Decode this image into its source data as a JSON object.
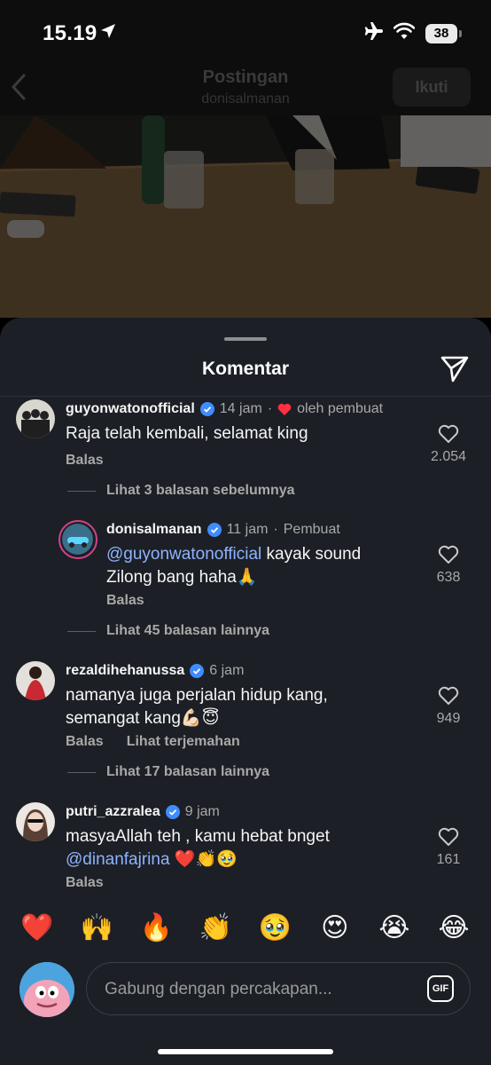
{
  "status_bar": {
    "time": "15.19",
    "battery": "38",
    "icons": [
      "location-arrow-icon",
      "airplane-icon",
      "wifi-icon",
      "battery-icon"
    ]
  },
  "nav": {
    "title": "Postingan",
    "subtitle": "donisalmanan",
    "follow_label": "Ikuti",
    "back_icon": "chevron-left-icon"
  },
  "sheet": {
    "title": "Komentar",
    "share_icon": "send-icon"
  },
  "comments": [
    {
      "username": "guyonwatonofficial",
      "verified": true,
      "time": "14 jam",
      "creator_tag": "oleh pembuat",
      "text": "Raja telah kembali, selamat king",
      "reply_label": "Balas",
      "likes": "2.054",
      "more_replies": "Lihat 3 balasan sebelumnya"
    },
    {
      "username": "donisalmanan",
      "verified": true,
      "time": "11 jam",
      "role": "Pembuat",
      "mention": "@guyonwatonofficial",
      "text_after_mention": " kayak sound",
      "text_line2": "Zilong bang  haha🙏",
      "reply_label": "Balas",
      "likes": "638",
      "more_replies": "Lihat 45 balasan lainnya"
    },
    {
      "username": "rezaldihehanussa",
      "verified": true,
      "time": "6 jam",
      "text_line1": "namanya juga perjalan hidup kang,",
      "text_line2": "semangat kang💪🏻😇",
      "reply_label": "Balas",
      "translate_label": "Lihat terjemahan",
      "likes": "949",
      "more_replies": "Lihat 17 balasan lainnya"
    },
    {
      "username": "putri_azzralea",
      "verified": true,
      "time": "9 jam",
      "text_line1": "masyaAllah teh , kamu hebat bnget",
      "mention": "@dinanfajrina",
      "text_after_mention": " ❤️👏🥹",
      "reply_label": "Balas",
      "likes": "161"
    }
  ],
  "emoji_bar": [
    "❤️",
    "🙌",
    "🔥",
    "👏",
    "🥹",
    "😍",
    "😭",
    "😂"
  ],
  "composer": {
    "placeholder": "Gabung dengan percakapan...",
    "gif_label": "GIF"
  },
  "colors": {
    "sheet_bg": "#1c1f25",
    "mention": "#8fb3ff",
    "verified": "#3f8cff",
    "heart_red": "#ff3040"
  }
}
